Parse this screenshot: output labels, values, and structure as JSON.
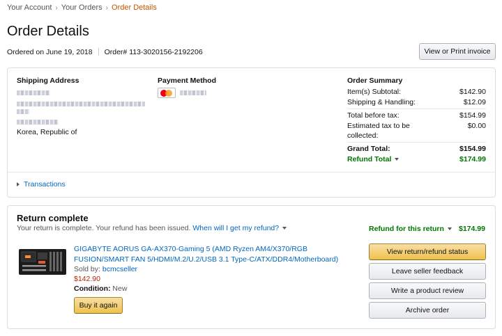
{
  "breadcrumb": {
    "items": [
      "Your Account",
      "Your Orders"
    ],
    "current": "Order Details",
    "separator": "›"
  },
  "page": {
    "title": "Order Details"
  },
  "order": {
    "ordered_on": "Ordered on June 19, 2018",
    "order_number": "Order# 113-3020156-2192206",
    "invoice_button": "View or Print invoice"
  },
  "shipping": {
    "heading": "Shipping Address",
    "country": "Korea, Republic of"
  },
  "payment": {
    "heading": "Payment Method",
    "card_icon": "mastercard-icon"
  },
  "summary": {
    "heading": "Order Summary",
    "rows": [
      {
        "label": "Item(s) Subtotal:",
        "value": "$142.90"
      },
      {
        "label": "Shipping & Handling:",
        "value": "$12.09"
      },
      {
        "label": "Total before tax:",
        "value": "$154.99"
      },
      {
        "label": "Estimated tax to be",
        "label2": "collected:",
        "value": "$0.00"
      }
    ],
    "grand_total_label": "Grand Total:",
    "grand_total_value": "$154.99",
    "refund_total_label": "Refund Total",
    "refund_total_value": "$174.99"
  },
  "transactions": {
    "label": "Transactions"
  },
  "return": {
    "heading": "Return complete",
    "message": "Your return is complete. Your refund has been issued.",
    "refund_link": "When will I get my refund?",
    "refund_label": "Refund for this return",
    "refund_value": "$174.99"
  },
  "item": {
    "title": "GIGABYTE AORUS GA-AX370-Gaming 5 (AMD Ryzen AM4/X370/RGB FUSION/SMART FAN 5/HDMI/M.2/U.2/USB 3.1 Type-C/ATX/DDR4/Motherboard)",
    "sold_by_label": "Sold by:",
    "seller": "bcmcseller",
    "price": "$142.90",
    "condition_label": "Condition:",
    "condition": "New",
    "buy_again": "Buy it again"
  },
  "actions": {
    "view_status": "View return/refund status",
    "seller_feedback": "Leave seller feedback",
    "review": "Write a product review",
    "archive": "Archive order"
  },
  "colors": {
    "link": "#0066c0",
    "breadcrumb_active": "#c45500",
    "green": "#007600",
    "price": "#b12704",
    "button_yellow": "#f0c14b"
  }
}
